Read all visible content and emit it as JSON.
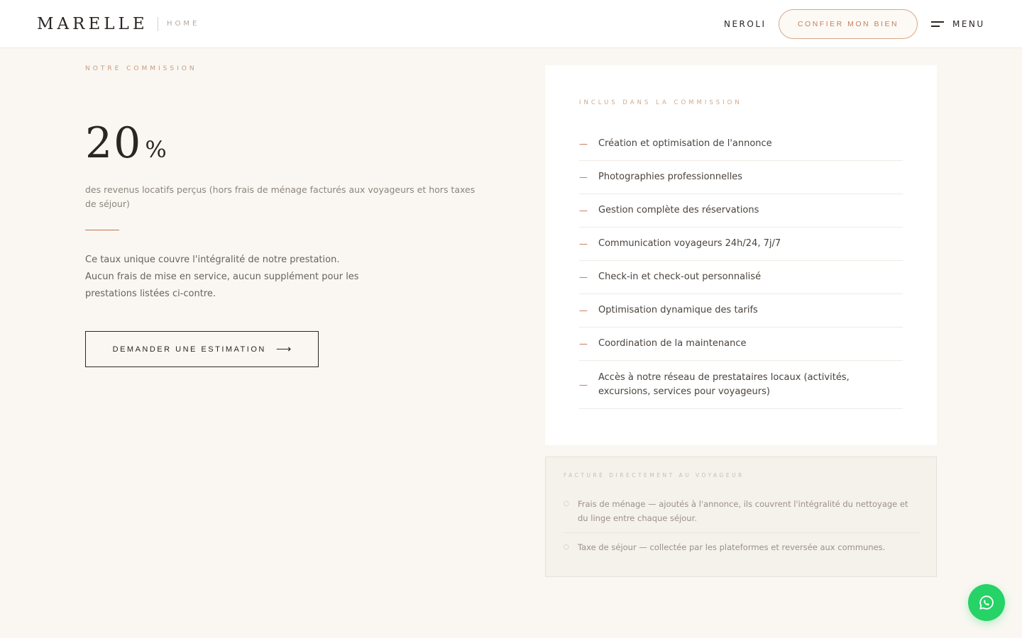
{
  "header": {
    "logo": "MARELLE",
    "logo_sub": "HOME",
    "nav_link": "NEROLI",
    "cta": "CONFIER MON BIEN",
    "menu_label": "MENU"
  },
  "commission": {
    "eyebrow": "NOTRE COMMISSION",
    "rate_value": "20",
    "rate_unit": "%",
    "rate_desc": "des revenus locatifs perçus (hors frais de ménage facturés aux voyageurs et hors taxes de séjour)",
    "body": "Ce taux unique couvre l'intégralité de notre prestation. Aucun frais de mise en service, aucun supplément pour les prestations listées ci-contre.",
    "button_label": "DEMANDER UNE ESTIMATION",
    "button_arrow": "⟶"
  },
  "included": {
    "eyebrow": "INCLUS DANS LA COMMISSION",
    "dash": "—",
    "items": [
      "Création et optimisation de l'annonce",
      "Photographies professionnelles",
      "Gestion complète des réservations",
      "Communication voyageurs 24h/24, 7j/7",
      "Check-in et check-out personnalisé",
      "Optimisation dynamique des tarifs",
      "Coordination de la maintenance",
      "Accès à notre réseau de prestataires locaux (activités, excursions, services pour voyageurs)"
    ]
  },
  "billed": {
    "eyebrow": "FACTURÉ DIRECTEMENT AU VOYAGEUR",
    "dot": "○",
    "items": [
      "Frais de ménage — ajoutés à l'annonce, ils couvrent l'intégralité du nettoyage et du linge entre chaque séjour.",
      "Taxe de séjour — collectée par les plateformes et reversée aux communes."
    ]
  },
  "icons": {
    "menu": "menu-icon",
    "arrow": "arrow-right-icon",
    "whatsapp": "whatsapp-icon"
  },
  "colors": {
    "accent": "#c4704b",
    "background": "#faf7f2",
    "whatsapp": "#25d366"
  }
}
